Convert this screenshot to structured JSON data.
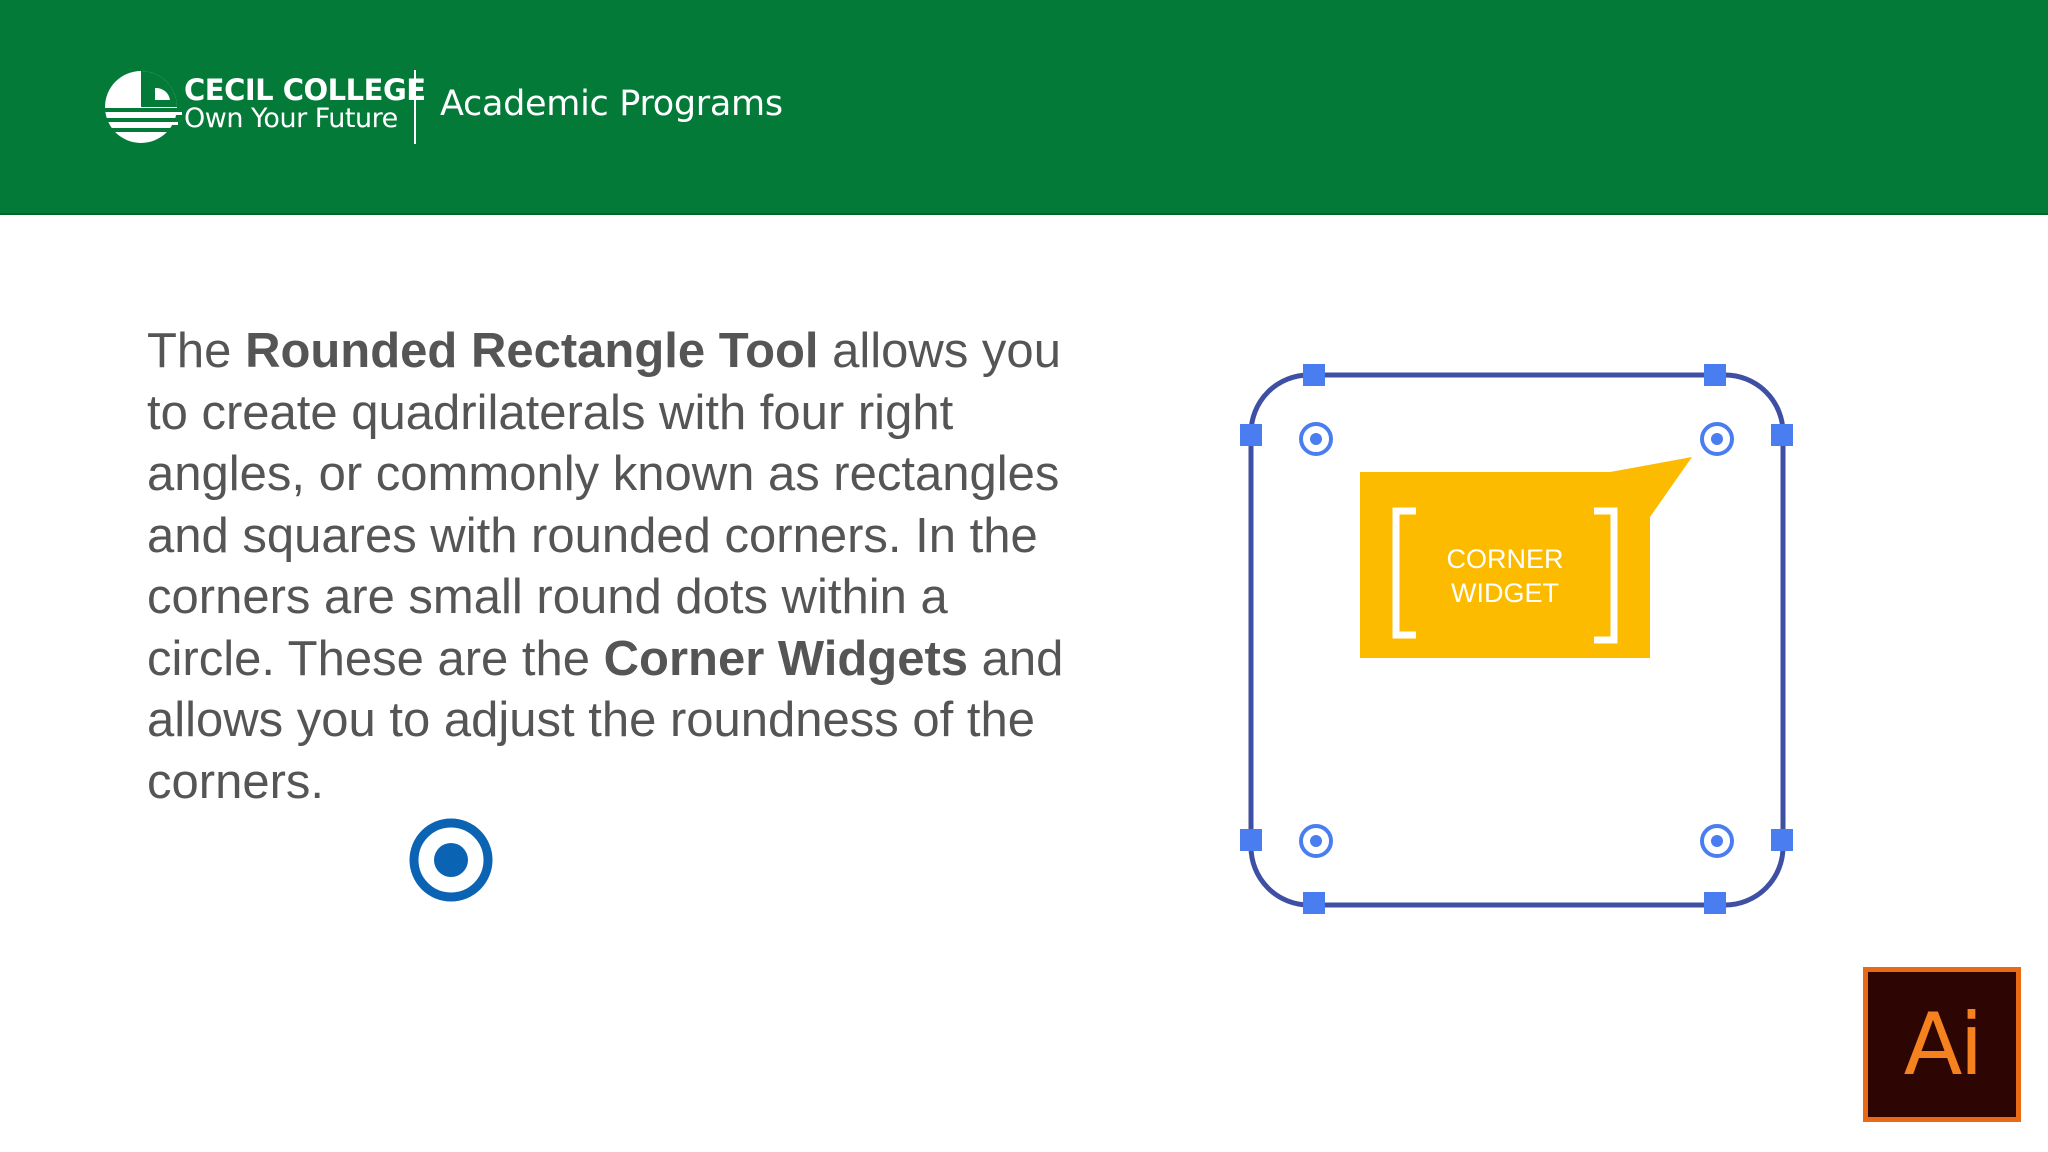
{
  "header": {
    "college_name": "CECIL COLLEGE",
    "college_tagline": "Own Your Future",
    "program_title": "Academic Programs",
    "background_color": "#037a38"
  },
  "slide": {
    "lines": [
      {
        "before": "The ",
        "bold": "Rounded Rectangle Tool",
        "after": " allows you"
      },
      {
        "before": "to create quadrilaterals with four right",
        "bold": "",
        "after": ""
      },
      {
        "before": "angles, or commonly known as rectangles",
        "bold": "",
        "after": ""
      },
      {
        "before": "and squares with rounded corners. In the",
        "bold": "",
        "after": ""
      },
      {
        "before": "corners are small round dots within a",
        "bold": "",
        "after": ""
      },
      {
        "before": "circle. These are the ",
        "bold": "Corner Widgets",
        "after": " and"
      },
      {
        "before": "allows you to adjust the roundness of the",
        "bold": "",
        "after": ""
      },
      {
        "before": "corners.",
        "bold": "",
        "after": ""
      }
    ]
  },
  "illustration": {
    "callout_line1": "CORNER",
    "callout_line2": "WIDGET",
    "callout_color": "#fdbb00",
    "frame_color": "#3f4fa3",
    "handle_color": "#4a7ef0"
  },
  "app_badge": {
    "text": "Ai",
    "accent_color": "#f5821f"
  },
  "icons": {
    "college_logo": "sun-horizon-icon",
    "corner_widget": "target-dot-icon",
    "app_badge": "adobe-illustrator-icon"
  }
}
